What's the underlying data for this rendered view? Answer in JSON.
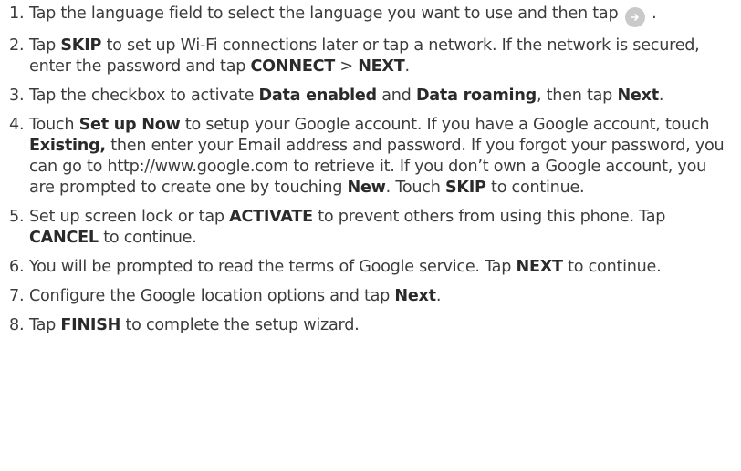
{
  "steps": [
    {
      "number": "1.",
      "parts": [
        {
          "text": "Tap the language field to select the language you want to use and then tap "
        },
        {
          "icon": "arrow-right-circle-icon"
        },
        {
          "text": "."
        }
      ]
    },
    {
      "number": "2.",
      "parts": [
        {
          "text": "Tap "
        },
        {
          "text": "SKIP",
          "bold": true
        },
        {
          "text": " to set up Wi-Fi connections later or tap a network. If the network is secured, enter the password and tap "
        },
        {
          "text": "CONNECT",
          "bold": true
        },
        {
          "text": " > "
        },
        {
          "text": "NEXT",
          "bold": true
        },
        {
          "text": "."
        }
      ]
    },
    {
      "number": "3.",
      "parts": [
        {
          "text": "Tap the checkbox to activate "
        },
        {
          "text": "Data enabled",
          "bold": true
        },
        {
          "text": " and "
        },
        {
          "text": "Data roaming",
          "bold": true
        },
        {
          "text": ", then tap "
        },
        {
          "text": "Next",
          "bold": true
        },
        {
          "text": "."
        }
      ]
    },
    {
      "number": "4.",
      "parts": [
        {
          "text": "Touch "
        },
        {
          "text": "Set up Now",
          "bold": true
        },
        {
          "text": " to setup your Google account. If you have a Google account, touch "
        },
        {
          "text": "Existing,",
          "bold": true
        },
        {
          "text": " then enter your Email address and password. If you forgot your password, you can go to http://www.google.com to retrieve it. If you don’t own a Google account, you are prompted to create one by touching "
        },
        {
          "text": "New",
          "bold": true
        },
        {
          "text": ". Touch "
        },
        {
          "text": "SKIP",
          "bold": true
        },
        {
          "text": " to continue."
        }
      ]
    },
    {
      "number": "5.",
      "parts": [
        {
          "text": "Set up screen lock or tap "
        },
        {
          "text": "ACTIVATE",
          "bold": true
        },
        {
          "text": " to prevent others from using this phone. Tap "
        },
        {
          "text": "CANCEL",
          "bold": true
        },
        {
          "text": " to continue."
        }
      ]
    },
    {
      "number": "6.",
      "parts": [
        {
          "text": "You will be prompted to read the terms of Google service. Tap "
        },
        {
          "text": "NEXT",
          "bold": true
        },
        {
          "text": " to continue."
        }
      ]
    },
    {
      "number": "7.",
      "parts": [
        {
          "text": "Configure the Google location options and tap "
        },
        {
          "text": "Next",
          "bold": true
        },
        {
          "text": "."
        }
      ]
    },
    {
      "number": "8.",
      "parts": [
        {
          "text": "Tap "
        },
        {
          "text": "FINISH",
          "bold": true
        },
        {
          "text": " to complete the setup wizard."
        }
      ]
    }
  ],
  "colors": {
    "text": "#3c3c3c",
    "icon_bg": "#c9c9c9",
    "icon_fg": "#ffffff"
  }
}
